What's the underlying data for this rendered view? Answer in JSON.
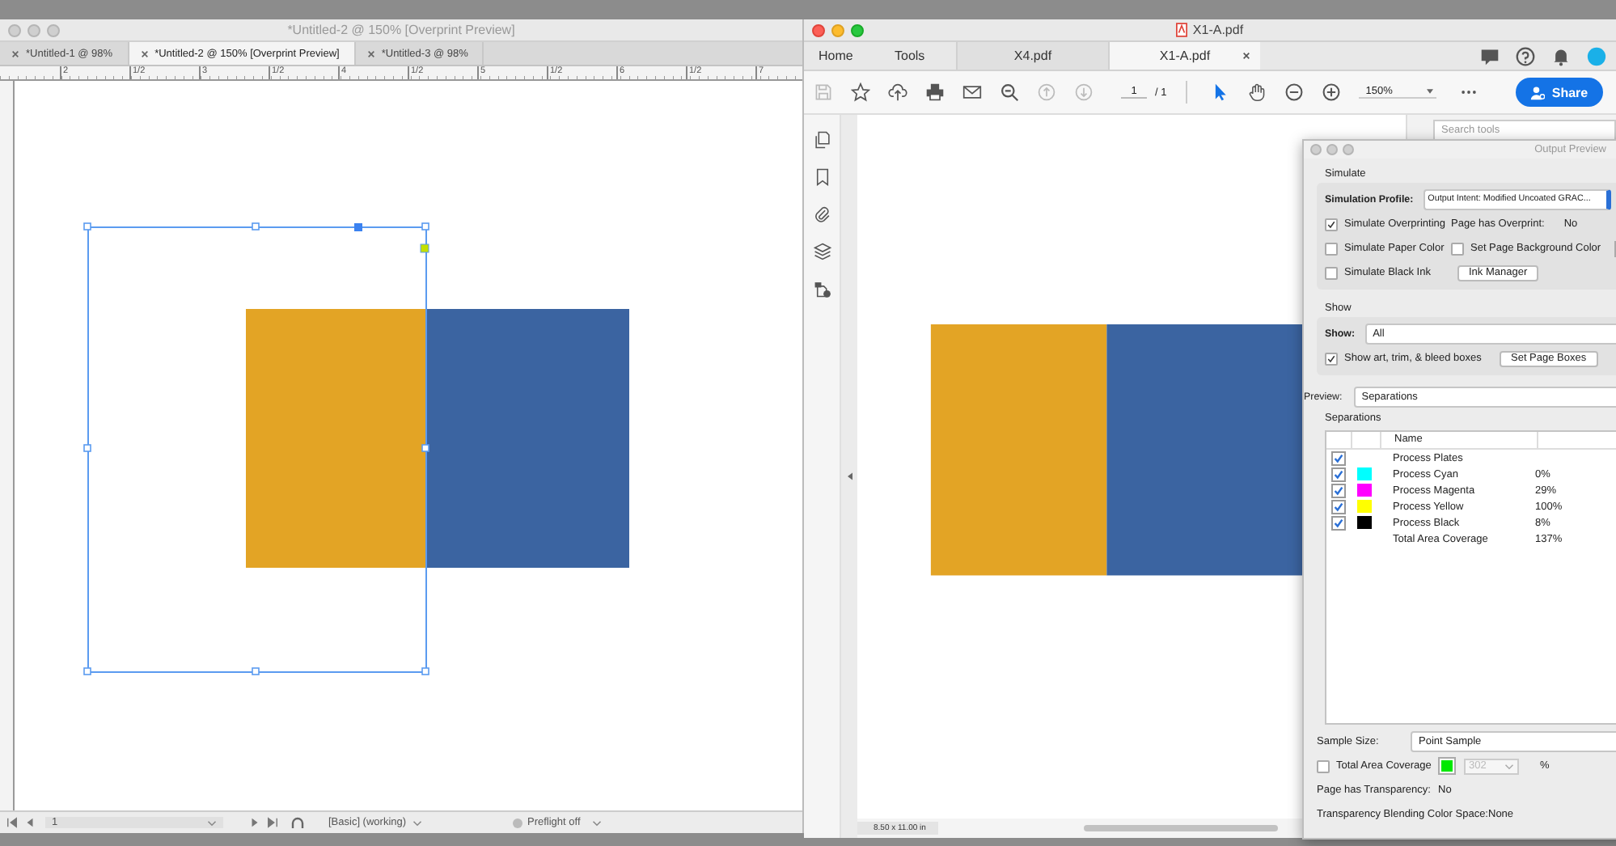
{
  "indesign": {
    "title": "*Untitled-2 @ 150% [Overprint Preview]",
    "tabs": [
      {
        "label": "*Untitled-1 @ 98%",
        "selected": false
      },
      {
        "label": "*Untitled-2 @ 150% [Overprint Preview]",
        "selected": true
      },
      {
        "label": "*Untitled-3 @ 98%",
        "selected": false
      }
    ],
    "ruler_labels": [
      "2",
      "1/2",
      "3",
      "1/2",
      "4",
      "1/2",
      "5",
      "1/2",
      "6",
      "1/2",
      "7"
    ],
    "status_bar": {
      "page": "1",
      "style": "[Basic] (working)",
      "preflight": "Preflight off"
    }
  },
  "acrobat": {
    "title": "X1-A.pdf",
    "nav": [
      "Home",
      "Tools"
    ],
    "tabs": [
      {
        "label": "X4.pdf",
        "selected": false
      },
      {
        "label": "X1-A.pdf",
        "selected": true
      }
    ],
    "page": {
      "current": "1",
      "total": "/ 1"
    },
    "zoom": "150%",
    "share_button": "Share",
    "search_placeholder": "Search tools",
    "page_size": "8.50 x 11.00 in"
  },
  "output_preview": {
    "title": "Output Preview",
    "simulate": {
      "heading": "Simulate",
      "profile_label": "Simulation Profile:",
      "profile": "Output Intent: Modified Uncoated GRAC...",
      "options": [
        {
          "label": "Simulate Overprinting",
          "checked": true
        },
        {
          "label": "Simulate Paper Color",
          "checked": false
        },
        {
          "label": "Set Page Background Color",
          "checked": false
        },
        {
          "label": "Simulate Black Ink",
          "checked": false
        }
      ],
      "overprint_label": "Page has Overprint:",
      "overprint_value": "No",
      "ink_manager_button": "Ink Manager"
    },
    "show": {
      "heading": "Show",
      "label": "Show:",
      "value": "All",
      "boxes_option": {
        "label": "Show art, trim, & bleed boxes",
        "checked": true
      },
      "page_boxes_button": "Set Page Boxes"
    },
    "preview": {
      "label": "Preview:",
      "value": "Separations"
    },
    "separations": {
      "heading": "Separations",
      "column": "Name",
      "rows": [
        {
          "kind": "plate",
          "name": "Process Plates",
          "checked": true
        },
        {
          "kind": "ink",
          "name": "Process Cyan",
          "checked": true,
          "color": "#00ffff",
          "coverage": "0%"
        },
        {
          "kind": "ink",
          "name": "Process Magenta",
          "checked": true,
          "color": "#ff00ff",
          "coverage": "29%"
        },
        {
          "kind": "ink",
          "name": "Process Yellow",
          "checked": true,
          "color": "#ffff00",
          "coverage": "100%"
        },
        {
          "kind": "ink",
          "name": "Process Black",
          "checked": true,
          "color": "#000000",
          "coverage": "8%"
        },
        {
          "kind": "total",
          "name": "Total Area Coverage",
          "coverage": "137%"
        }
      ]
    },
    "sample_size": {
      "label": "Sample Size:",
      "value": "Point Sample"
    },
    "total_area_coverage": {
      "label": "Total Area Coverage",
      "checked": false,
      "value": "302",
      "disabled": true,
      "unit": "%"
    },
    "transparency": {
      "label": "Page has Transparency:",
      "value": "No"
    },
    "blending_space": {
      "label": "Transparency Blending Color Space:",
      "value": "None"
    }
  }
}
